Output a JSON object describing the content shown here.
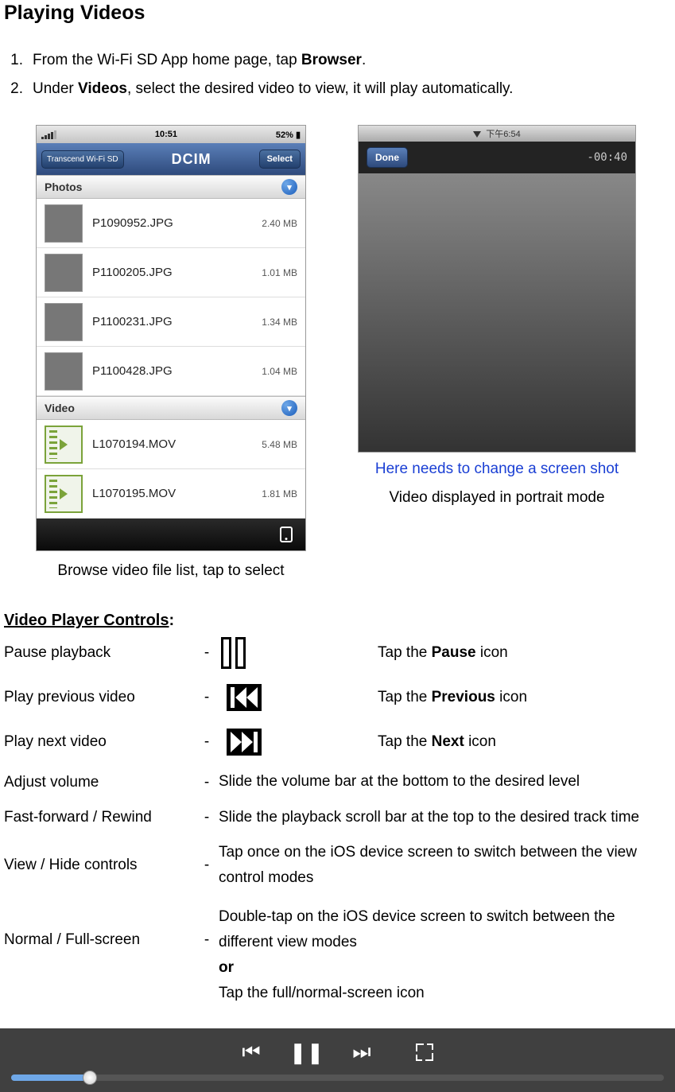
{
  "title": "Playing Videos",
  "instructions": [
    {
      "num": "1.",
      "prefix": "From the Wi-Fi SD App home page, tap ",
      "bold": "Browser",
      "suffix": "."
    },
    {
      "num": "2.",
      "prefix": "Under ",
      "bold": "Videos",
      "suffix": ", select the desired video to view, it will play automatically."
    }
  ],
  "left_screenshot": {
    "statusbar": {
      "time": "10:51",
      "battery": "52%"
    },
    "navbar": {
      "back": "Transcend Wi-Fi SD",
      "title": "DCIM",
      "select": "Select"
    },
    "sections": {
      "photos_header": "Photos",
      "video_header": "Video"
    },
    "photo_files": [
      {
        "name": "P1090952.JPG",
        "size": "2.40 MB"
      },
      {
        "name": "P1100205.JPG",
        "size": "1.01 MB"
      },
      {
        "name": "P1100231.JPG",
        "size": "1.34 MB"
      },
      {
        "name": "P1100428.JPG",
        "size": "1.04 MB"
      }
    ],
    "video_files": [
      {
        "name": "L1070194.MOV",
        "size": "5.48 MB"
      },
      {
        "name": "L1070195.MOV",
        "size": "1.81 MB"
      }
    ],
    "caption": "Browse video file list, tap to select"
  },
  "right_screenshot": {
    "statusbar_time": "下午6:54",
    "done": "Done",
    "remaining": "-00:40",
    "note": "Here needs to change a screen shot",
    "caption": "Video displayed in portrait mode"
  },
  "controls_section": {
    "title": "Video Player Controls",
    "colon": ":",
    "rows": [
      {
        "label": "Pause playback",
        "icon": "pause",
        "desc_prefix": "Tap the ",
        "desc_bold": "Pause",
        "desc_suffix": " icon"
      },
      {
        "label": "Play previous video",
        "icon": "previous",
        "desc_prefix": "Tap the ",
        "desc_bold": "Previous",
        "desc_suffix": " icon"
      },
      {
        "label": "Play next video",
        "icon": "next",
        "desc_prefix": "Tap the ",
        "desc_bold": "Next",
        "desc_suffix": " icon"
      },
      {
        "label": "Adjust volume",
        "desc": "Slide the volume bar at the bottom to the desired level"
      },
      {
        "label": "Fast-forward / Rewind",
        "desc": "Slide the playback scroll bar at the top to the desired track time"
      },
      {
        "label": "View / Hide controls",
        "desc": "Tap once on the iOS device screen to switch between the view control modes"
      },
      {
        "label": "Normal / Full-screen",
        "desc_line1": "Double-tap on the iOS device screen to switch between the different view modes",
        "desc_or": "or",
        "desc_line2": "Tap the full/normal-screen icon"
      }
    ]
  }
}
